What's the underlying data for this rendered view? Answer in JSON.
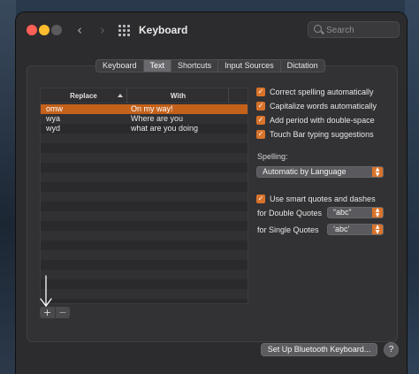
{
  "window": {
    "title": "Keyboard",
    "back_icon": "chevron-left-icon",
    "forward_icon": "chevron-right-icon",
    "grid_icon": "show-all-grid-icon"
  },
  "search": {
    "placeholder": "Search",
    "value": ""
  },
  "tabs": [
    {
      "label": "Keyboard",
      "active": false
    },
    {
      "label": "Text",
      "active": true
    },
    {
      "label": "Shortcuts",
      "active": false
    },
    {
      "label": "Input Sources",
      "active": false
    },
    {
      "label": "Dictation",
      "active": false
    }
  ],
  "replacements": {
    "columns": [
      "Replace",
      "With"
    ],
    "rows": [
      {
        "replace": "omw",
        "with": "On my way!",
        "selected": true
      },
      {
        "replace": "wya",
        "with": "Where are you",
        "selected": false
      },
      {
        "replace": "wyd",
        "with": "what are you doing",
        "selected": false
      }
    ],
    "add_label": "+",
    "remove_label": "−"
  },
  "options": {
    "correct_spelling": {
      "label": "Correct spelling automatically",
      "checked": true
    },
    "capitalize_words": {
      "label": "Capitalize words automatically",
      "checked": true
    },
    "period_double_space": {
      "label": "Add period with double-space",
      "checked": true
    },
    "touch_bar_suggestions": {
      "label": "Touch Bar typing suggestions",
      "checked": true
    }
  },
  "spelling": {
    "label": "Spelling:",
    "value": "Automatic by Language"
  },
  "smart_quotes": {
    "label": "Use smart quotes and dashes",
    "checked": true,
    "double_label": "for Double Quotes",
    "double_value": "“abc”",
    "single_label": "for Single Quotes",
    "single_value": "‘abc’"
  },
  "footer": {
    "bluetooth_button": "Set Up Bluetooth Keyboard...",
    "help_button": "?"
  },
  "colors": {
    "accent": "#d9732a",
    "selection": "#c4621c",
    "window_bg": "#2c2c2e"
  }
}
